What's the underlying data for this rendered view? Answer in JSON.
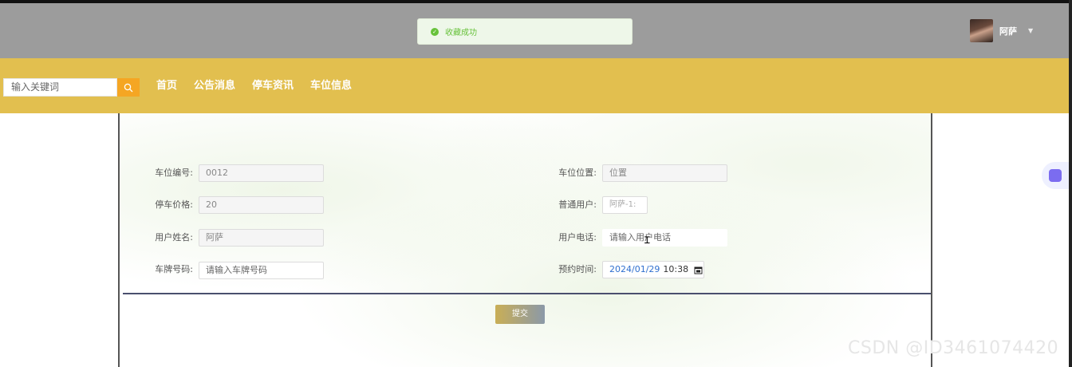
{
  "toast": {
    "message": "收藏成功",
    "color": "#67c23a"
  },
  "user": {
    "name": "阿萨"
  },
  "search": {
    "placeholder": "输入关键词"
  },
  "nav": [
    "首页",
    "公告消息",
    "停车资讯",
    "车位信息"
  ],
  "form": {
    "parking_no": {
      "label": "车位编号:",
      "value": "0012"
    },
    "parking_location": {
      "label": "车位位置:",
      "value": "位置"
    },
    "price": {
      "label": "停车价格:",
      "value": "20"
    },
    "normal_user": {
      "label": "普通用户:",
      "value": "阿萨-1:"
    },
    "user_name": {
      "label": "用户姓名:",
      "value": "阿萨"
    },
    "user_phone": {
      "label": "用户电话:",
      "placeholder": "请输入用户电话"
    },
    "plate_no": {
      "label": "车牌号码:",
      "placeholder": "请输入车牌号码"
    },
    "reserve_time": {
      "label": "预约时间:",
      "date": "2024/01/29",
      "time": "10:38"
    }
  },
  "submit_label": "提交",
  "watermark": "CSDN @ID3461074420",
  "colors": {
    "navbar": "#e2bf4f",
    "header": "#9c9c9c",
    "search_button": "#f5a623"
  }
}
